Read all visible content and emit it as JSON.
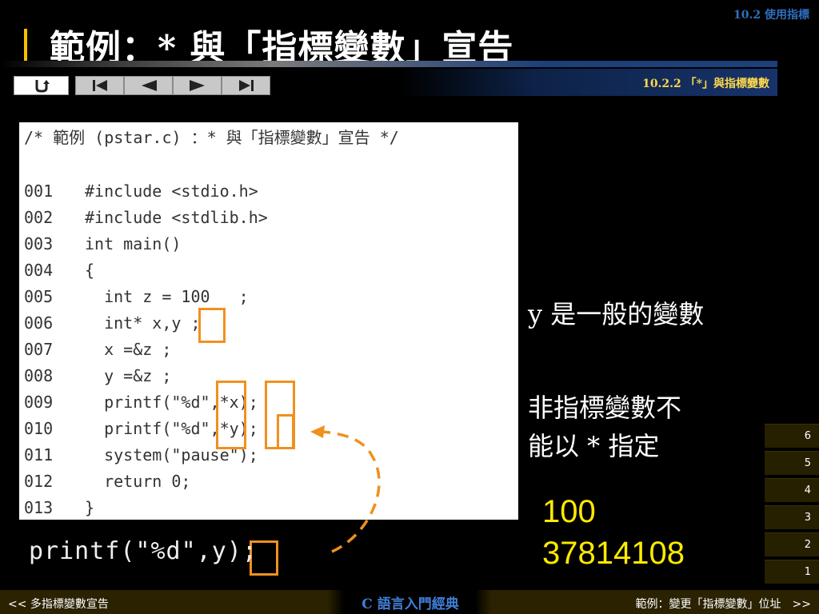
{
  "header": {
    "section_label": "10.2 使用指標",
    "title": "範例：* 與「指標變數」宣告",
    "subtitle": "10.2.2 「*」與指標變數"
  },
  "nav": [
    {
      "name": "return-button",
      "icon": "return-icon"
    },
    {
      "name": "first-slide-button",
      "icon": "skip-first-icon"
    },
    {
      "name": "prev-slide-button",
      "icon": "triangle-left-icon"
    },
    {
      "name": "next-slide-button",
      "icon": "triangle-right-icon"
    },
    {
      "name": "last-slide-button",
      "icon": "skip-last-icon"
    }
  ],
  "code": {
    "comment": "/* 範例 (pstar.c) ：* 與「指標變數」宣告 */",
    "lines": [
      {
        "num": "001",
        "text": "#include <stdio.h>"
      },
      {
        "num": "002",
        "text": "#include <stdlib.h>"
      },
      {
        "num": "003",
        "text": "int main()"
      },
      {
        "num": "004",
        "text": "{"
      },
      {
        "num": "005",
        "text": "  int z = 100   ;"
      },
      {
        "num": "006",
        "text": "  int* x,y ;"
      },
      {
        "num": "007",
        "text": "  x =&z ;"
      },
      {
        "num": "008",
        "text": "  y =&z ;"
      },
      {
        "num": "009",
        "text": "  printf(\"%d\",*x);"
      },
      {
        "num": "010",
        "text": "  printf(\"%d\",*y);"
      },
      {
        "num": "011",
        "text": "  system(\"pause\");"
      },
      {
        "num": "012",
        "text": "  return 0;"
      },
      {
        "num": "013",
        "text": "}"
      }
    ]
  },
  "bottom_code": "printf(\"%d\",y);",
  "notes": {
    "note1": "y 是一般的變數",
    "note2_line1": "非指標變數不",
    "note2_line2": "能以 * 指定"
  },
  "output": {
    "line1": "100",
    "line2": "37814108"
  },
  "page_buttons": [
    "6",
    "5",
    "4",
    "3",
    "2",
    "1"
  ],
  "footer": {
    "prev": "<< 多指標變數宣告",
    "center": "C 語言入門經典",
    "next": "範例：變更「指標變數」位址　>>"
  },
  "colors": {
    "highlight": "#f0901e",
    "output": "#ffea00",
    "accent": "#f5c000"
  }
}
